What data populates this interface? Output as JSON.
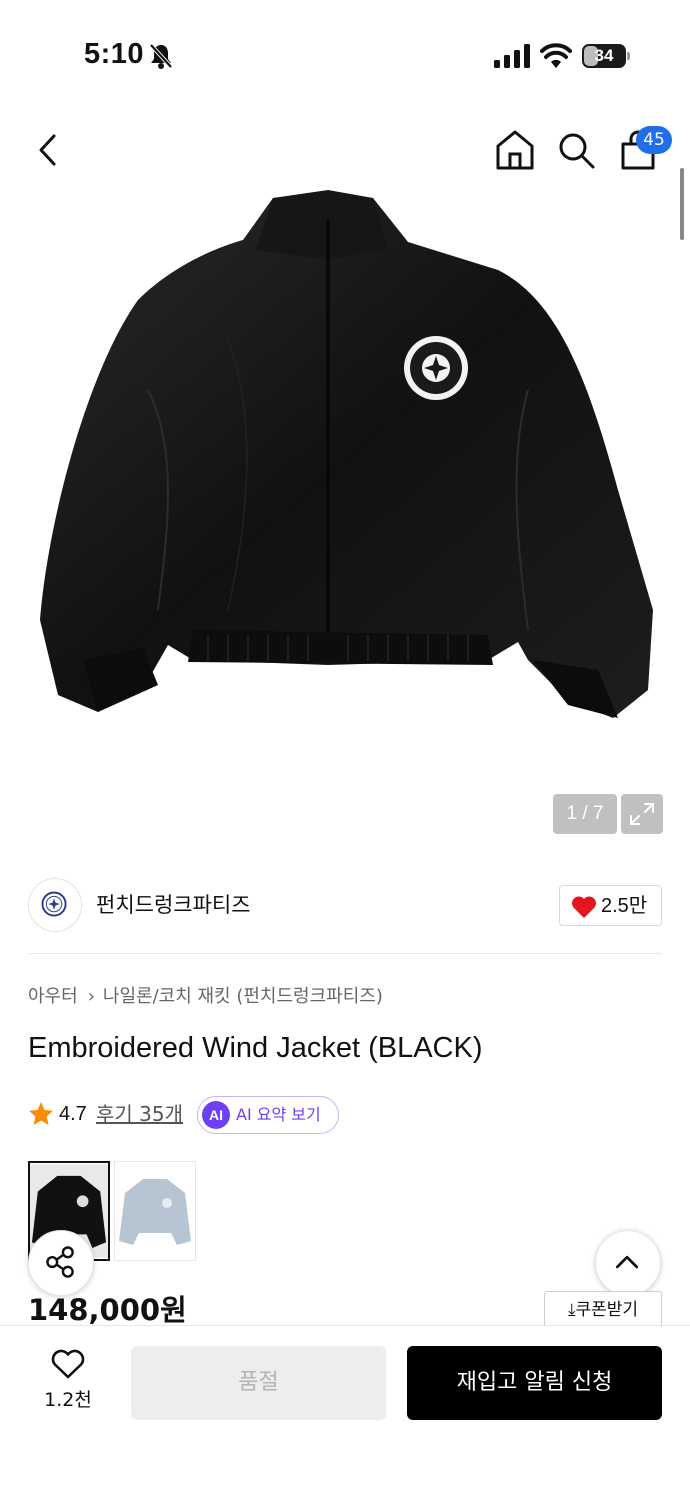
{
  "status_bar": {
    "time": "5:10",
    "battery": "34",
    "battery_fraction": 0.34
  },
  "nav": {
    "cart_badge": "45"
  },
  "gallery": {
    "pager": "1 / 7"
  },
  "brand": {
    "name": "펀치드렁크파티즈",
    "like_count": "2.5만",
    "logo_text": "PARTIES · PUNCH · DRUNK"
  },
  "product": {
    "category": "아우터",
    "subcategory": "나일론/코치 재킷 (펀치드렁크파티즈)",
    "title": "Embroidered Wind Jacket (BLACK)",
    "rating": "4.7",
    "reviews": "후기 35개",
    "ai_badge": "AI",
    "ai_summary": "AI 요약 보기",
    "price": "148,000원",
    "coupon": "쿠폰받기",
    "variants": [
      "black",
      "light-grey"
    ]
  },
  "bottom_bar": {
    "wish_count": "1.2천",
    "soldout_label": "품절",
    "restock_label": "재입고 알림 신청"
  },
  "colors": {
    "accent_blue": "#1f6feb",
    "ai_purple": "#6f3ff5",
    "heart_red": "#e4151f",
    "star_orange": "#ff8a00"
  },
  "icons": [
    "bell-slash-icon",
    "signal-icon",
    "wifi-icon",
    "battery-icon",
    "back-icon",
    "home-icon",
    "search-icon",
    "shopping-bag-icon",
    "expand-icon",
    "heart-icon",
    "star-icon",
    "share-icon",
    "chevron-up-icon",
    "download-icon"
  ]
}
